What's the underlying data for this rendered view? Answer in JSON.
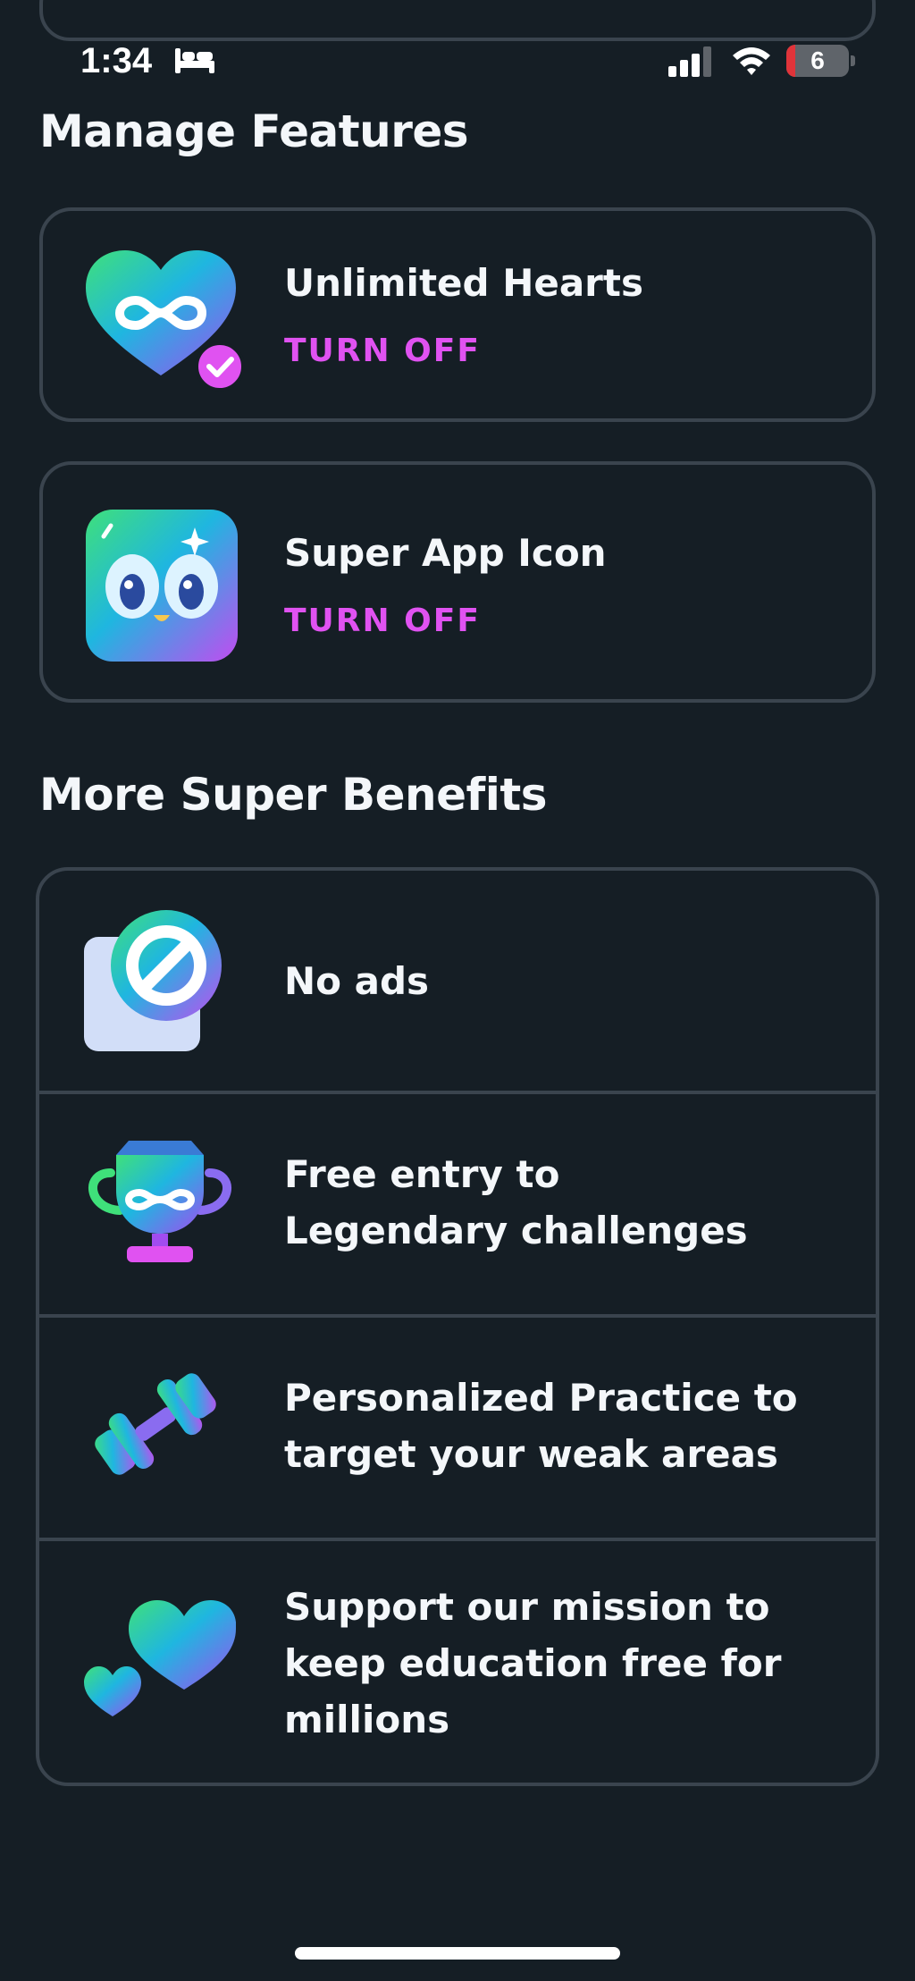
{
  "status_bar": {
    "time": "1:34",
    "battery_level": "6"
  },
  "manage_features": {
    "title": "Manage Features",
    "items": [
      {
        "label": "Unlimited Hearts",
        "action": "TURN OFF",
        "icon": "unlimited-hearts-icon"
      },
      {
        "label": "Super App Icon",
        "action": "TURN OFF",
        "icon": "super-app-icon"
      }
    ]
  },
  "more_benefits": {
    "title": "More Super Benefits",
    "items": [
      {
        "lines": [
          "No ads"
        ],
        "icon": "no-ads-icon"
      },
      {
        "lines": [
          "Free entry to",
          "Legendary challenges"
        ],
        "icon": "trophy-icon"
      },
      {
        "lines": [
          "Personalized Practice to",
          "target your weak areas"
        ],
        "icon": "dumbbell-icon"
      },
      {
        "lines": [
          "Support our mission to",
          "keep education free for",
          "millions"
        ],
        "icon": "hearts-icon"
      }
    ]
  },
  "colors": {
    "background": "#151E25",
    "card_border": "#3A444E",
    "action": "#E052F1",
    "text": "#F4F7FA"
  }
}
